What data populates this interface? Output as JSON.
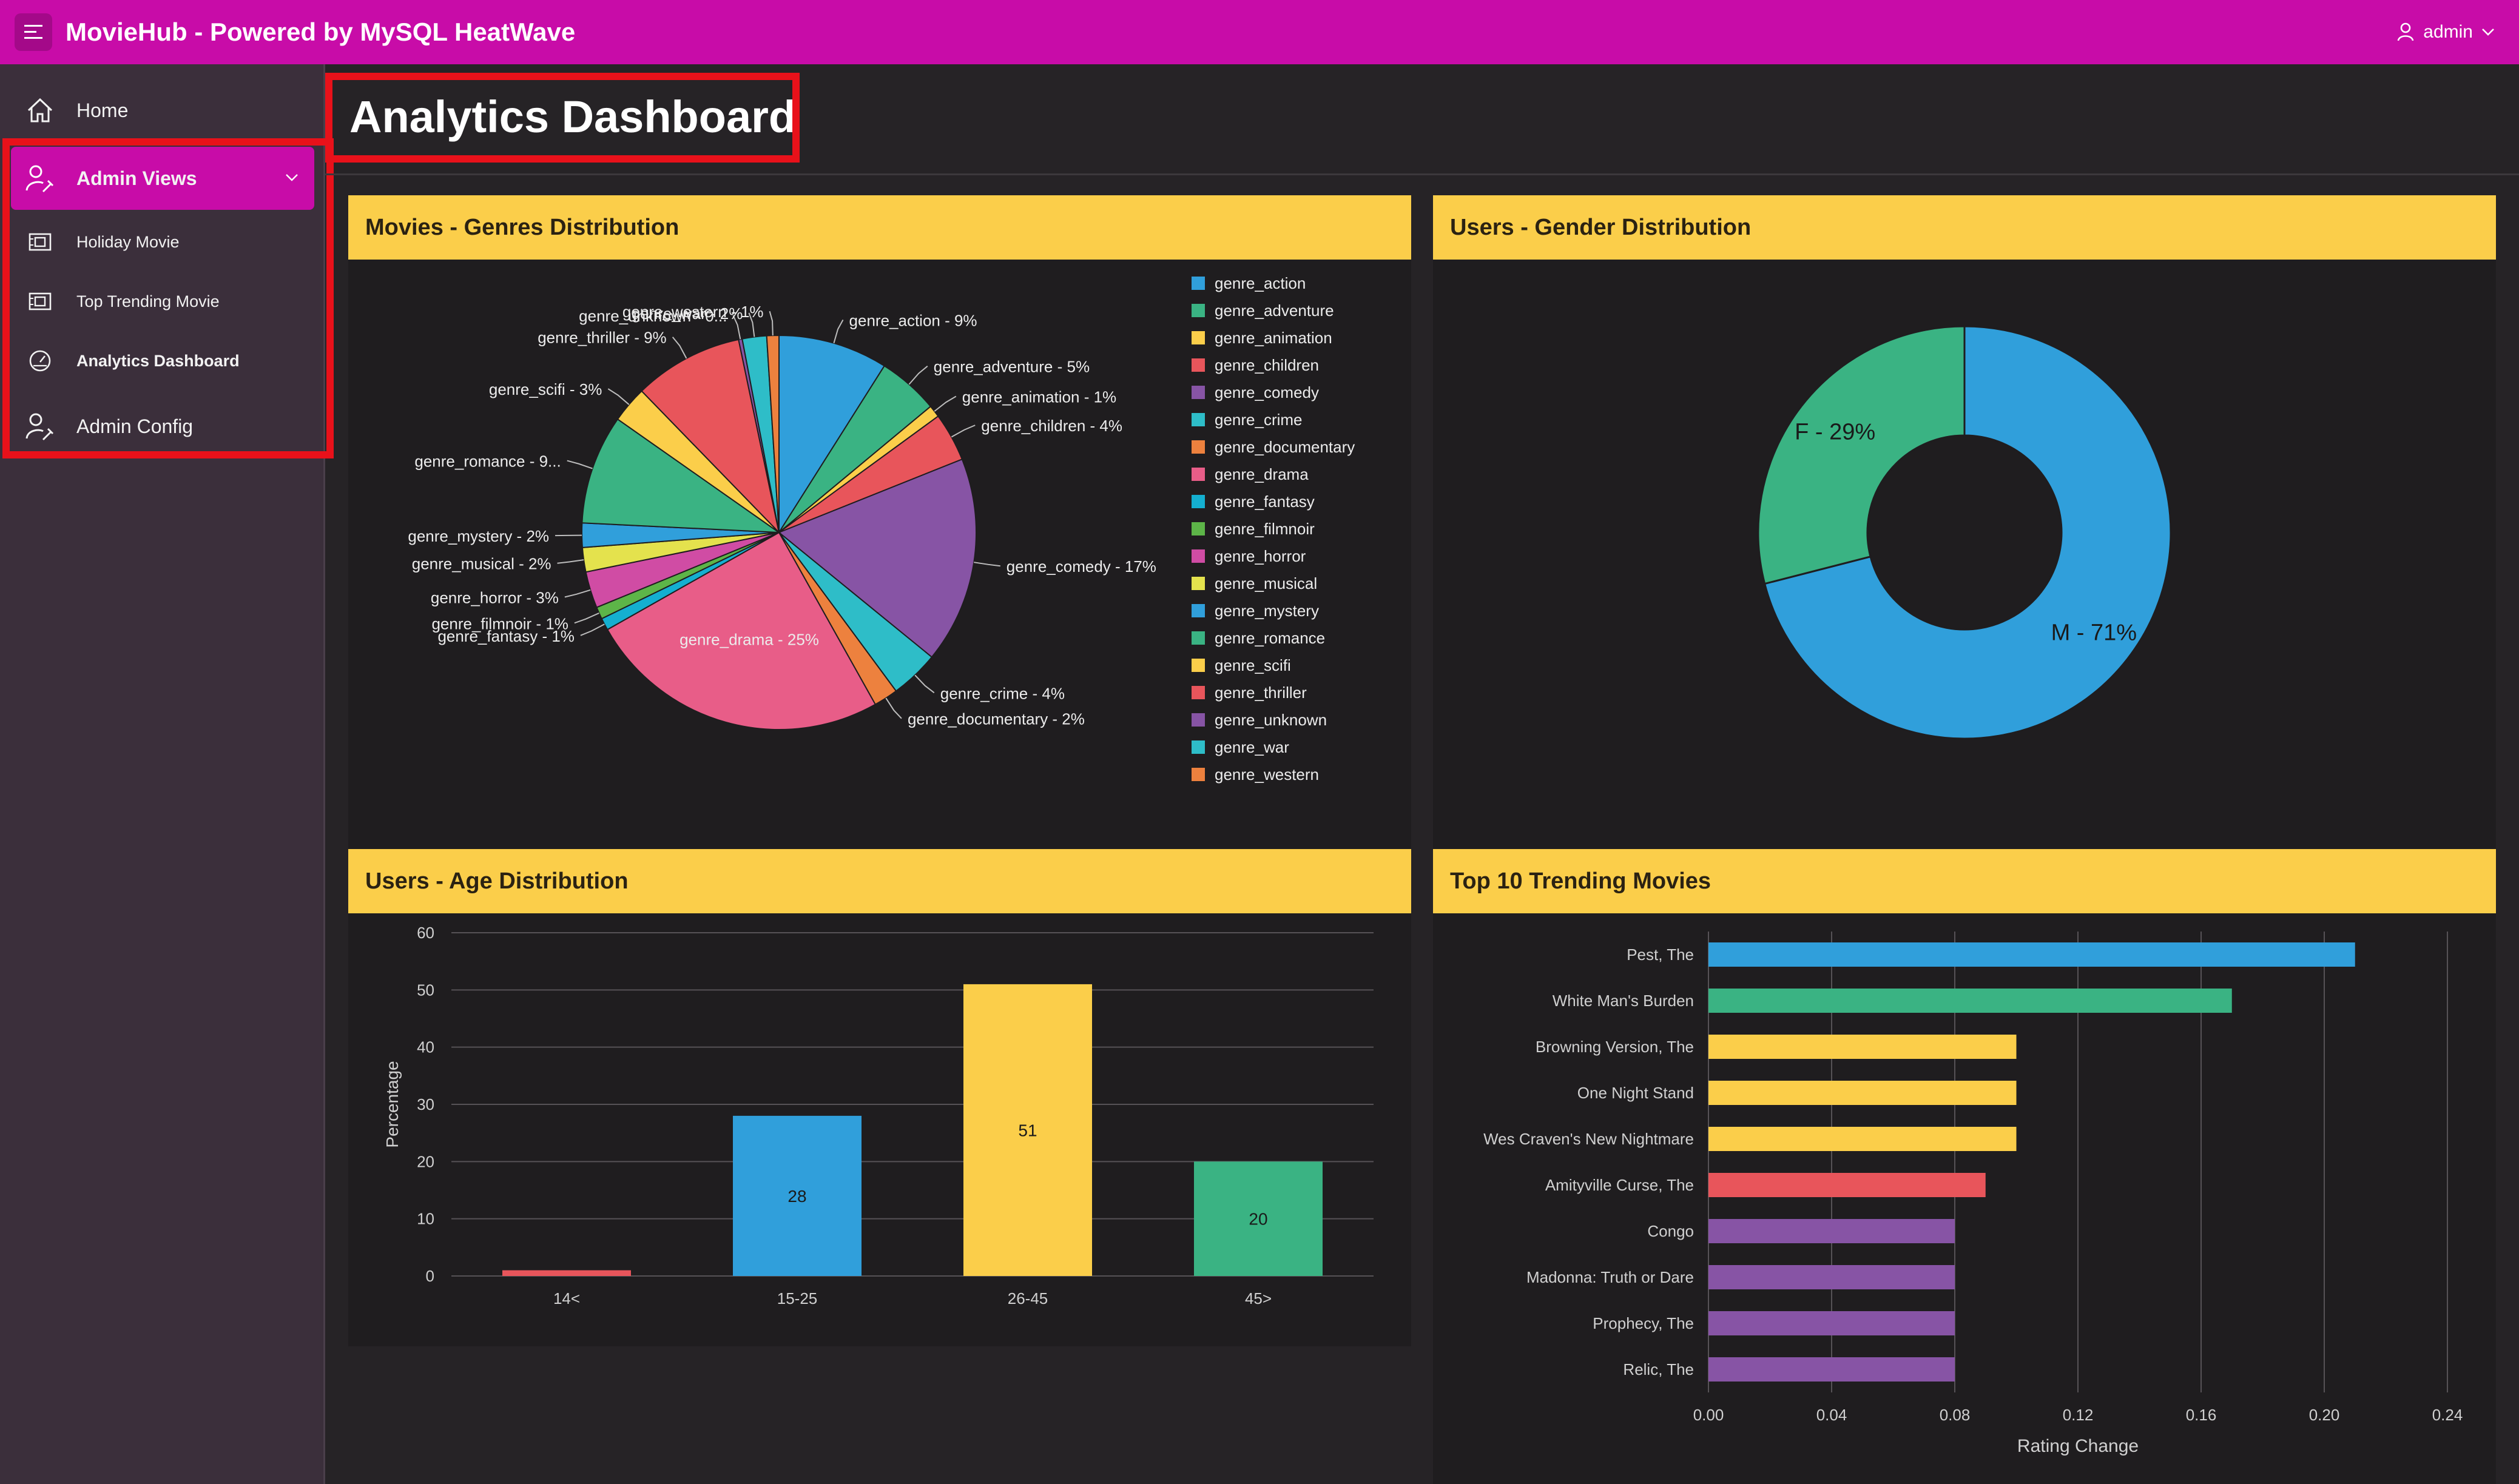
{
  "header": {
    "app_title": "MovieHub - Powered by MySQL HeatWave",
    "user": "admin"
  },
  "sidebar": {
    "items": [
      {
        "label": "Home"
      },
      {
        "label": "Admin Views"
      },
      {
        "label": "Holiday Movie"
      },
      {
        "label": "Top Trending Movie"
      },
      {
        "label": "Analytics Dashboard"
      },
      {
        "label": "Admin Config"
      }
    ]
  },
  "page": {
    "title": "Analytics Dashboard"
  },
  "colors": {
    "accent": "#c80ca8",
    "highlight": "#e8111a",
    "card_header": "#fbce4a"
  },
  "charts": {
    "genres": {
      "title": "Movies - Genres Distribution"
    },
    "gender": {
      "title": "Users - Gender Distribution"
    },
    "age": {
      "title": "Users - Age Distribution"
    },
    "trending": {
      "title": "Top 10 Trending Movies"
    }
  },
  "chart_data": [
    {
      "type": "pie",
      "title": "Movies - Genres Distribution",
      "slices": [
        {
          "name": "genre_action",
          "value": 9,
          "label": "genre_action - 9%",
          "color": "#309fdb"
        },
        {
          "name": "genre_adventure",
          "value": 5,
          "label": "genre_adventure - 5%",
          "color": "#3ab383"
        },
        {
          "name": "genre_animation",
          "value": 1,
          "label": "genre_animation - 1%",
          "color": "#fbce4a"
        },
        {
          "name": "genre_children",
          "value": 4,
          "label": "genre_children - 4%",
          "color": "#e8555b"
        },
        {
          "name": "genre_comedy",
          "value": 17,
          "label": "genre_comedy - 17%",
          "color": "#8754a5"
        },
        {
          "name": "genre_crime",
          "value": 4,
          "label": "genre_crime - 4%",
          "color": "#2ebdc8"
        },
        {
          "name": "genre_documentary",
          "value": 2,
          "label": "genre_documentary - 2%",
          "color": "#ed813e"
        },
        {
          "name": "genre_drama",
          "value": 25,
          "label": "genre_drama - 25%",
          "color": "#e85d88"
        },
        {
          "name": "genre_fantasy",
          "value": 1,
          "label": "genre_fantasy - 1%",
          "color": "#14afd0"
        },
        {
          "name": "genre_filmnoir",
          "value": 1,
          "label": "genre_filmnoir - 1%",
          "color": "#5db548"
        },
        {
          "name": "genre_horror",
          "value": 3,
          "label": "genre_horror - 3%",
          "color": "#d04ca4"
        },
        {
          "name": "genre_musical",
          "value": 2,
          "label": "genre_musical - 2%",
          "color": "#e4e24d"
        },
        {
          "name": "genre_mystery",
          "value": 2,
          "label": "genre_mystery - 2%",
          "color": "#309fdb"
        },
        {
          "name": "genre_romance",
          "value": 9,
          "label": "genre_romance - 9...",
          "color": "#3ab383"
        },
        {
          "name": "genre_scifi",
          "value": 3,
          "label": "genre_scifi - 3%",
          "color": "#fbce4a"
        },
        {
          "name": "genre_thriller",
          "value": 9,
          "label": "genre_thriller - 9%",
          "color": "#e8555b"
        },
        {
          "name": "genre_unknown",
          "value": 0.3,
          "label": "genre_unknown - 0...",
          "color": "#8754a5"
        },
        {
          "name": "genre_war",
          "value": 2,
          "label": "genre_war - 2%",
          "color": "#2ebdc8"
        },
        {
          "name": "genre_western",
          "value": 1,
          "label": "genre_western - 1%",
          "color": "#ed813e"
        }
      ],
      "legend": "right"
    },
    {
      "type": "pie",
      "title": "Users - Gender Distribution",
      "slices": [
        {
          "name": "M",
          "value": 71,
          "label": "M - 71%",
          "color": "#309fdb"
        },
        {
          "name": "F",
          "value": 29,
          "label": "F - 29%",
          "color": "#3ab383"
        }
      ]
    },
    {
      "type": "bar",
      "title": "Users - Age Distribution",
      "categories": [
        "14<",
        "15-25",
        "26-45",
        "45>"
      ],
      "values": [
        1,
        28,
        51,
        20
      ],
      "data_labels": [
        "",
        "28",
        "51",
        "20"
      ],
      "colors": [
        "#e8555b",
        "#309fdb",
        "#fbce4a",
        "#3ab383"
      ],
      "ylabel": "Percentage",
      "ylim": [
        0,
        60
      ],
      "yticks": [
        "0",
        "10",
        "20",
        "30",
        "40",
        "50",
        "60"
      ],
      "grid": true
    },
    {
      "type": "bar",
      "orientation": "horizontal",
      "title": "Top 10 Trending Movies",
      "categories": [
        "Pest, The",
        "White Man's Burden",
        "Browning Version, The",
        "One Night Stand",
        "Wes Craven's New Nightmare",
        "Amityville Curse, The",
        "Congo",
        "Madonna: Truth or Dare",
        "Prophecy, The",
        "Relic, The"
      ],
      "values": [
        0.21,
        0.17,
        0.1,
        0.1,
        0.1,
        0.09,
        0.08,
        0.08,
        0.08,
        0.08
      ],
      "colors": [
        "#309fdb",
        "#3ab383",
        "#fbce4a",
        "#fbce4a",
        "#fbce4a",
        "#e8555b",
        "#8754a5",
        "#8754a5",
        "#8754a5",
        "#8754a5"
      ],
      "xlabel": "Rating Change",
      "xlim": [
        0,
        0.24
      ],
      "xticks": [
        "0.00",
        "0.04",
        "0.08",
        "0.12",
        "0.16",
        "0.20",
        "0.24"
      ],
      "grid": true
    }
  ]
}
